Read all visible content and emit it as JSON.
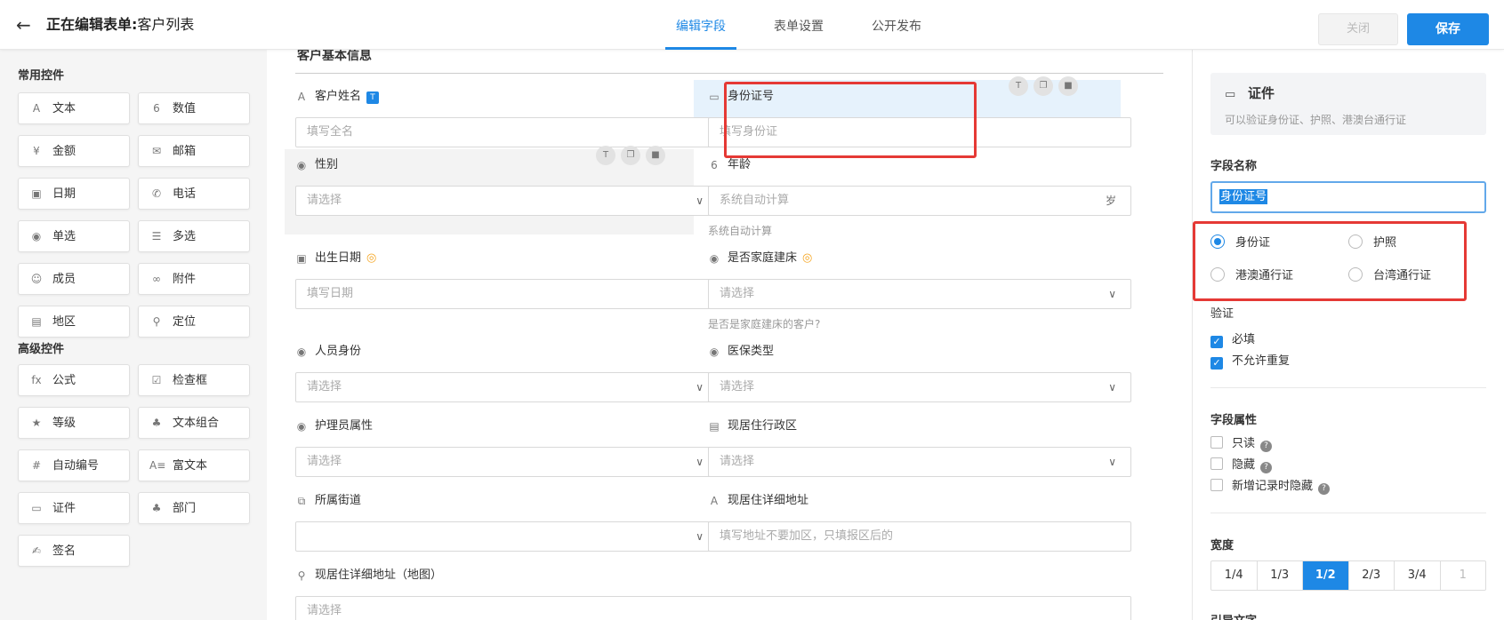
{
  "header": {
    "title_prefix": "正在编辑表单:",
    "form_name": "客户列表",
    "tabs": [
      "编辑字段",
      "表单设置",
      "公开发布"
    ],
    "close_label": "关闭",
    "save_label": "保存"
  },
  "palette": {
    "common_title": "常用控件",
    "advanced_title": "高级控件",
    "common": [
      {
        "label": "文本",
        "icon": "A"
      },
      {
        "label": "数值",
        "icon": "6"
      },
      {
        "label": "金额",
        "icon": "¥"
      },
      {
        "label": "邮箱",
        "icon": "✉"
      },
      {
        "label": "日期",
        "icon": "▣"
      },
      {
        "label": "电话",
        "icon": "✆"
      },
      {
        "label": "单选",
        "icon": "◉"
      },
      {
        "label": "多选",
        "icon": "☰"
      },
      {
        "label": "成员",
        "icon": "☺"
      },
      {
        "label": "附件",
        "icon": "∞"
      },
      {
        "label": "地区",
        "icon": "▤"
      },
      {
        "label": "定位",
        "icon": "⚲"
      }
    ],
    "advanced": [
      {
        "label": "公式",
        "icon": "fx"
      },
      {
        "label": "检查框",
        "icon": "☑"
      },
      {
        "label": "等级",
        "icon": "★"
      },
      {
        "label": "文本组合",
        "icon": "♣"
      },
      {
        "label": "自动编号",
        "icon": "#"
      },
      {
        "label": "富文本",
        "icon": "A≡"
      },
      {
        "label": "证件",
        "icon": "▭"
      },
      {
        "label": "部门",
        "icon": "♣"
      },
      {
        "label": "签名",
        "icon": "✍"
      }
    ]
  },
  "form": {
    "group_title": "客户基本信息",
    "fields": {
      "name": {
        "label": "客户姓名",
        "placeholder": "填写全名",
        "tag": "T"
      },
      "idcard": {
        "label": "身份证号",
        "placeholder": "填写身份证"
      },
      "gender": {
        "label": "性别",
        "placeholder": "请选择"
      },
      "age": {
        "label": "年龄",
        "placeholder": "系统自动计算",
        "unit": "岁",
        "hint": "系统自动计算"
      },
      "birth": {
        "label": "出生日期",
        "placeholder": "填写日期"
      },
      "homebed": {
        "label": "是否家庭建床",
        "placeholder": "请选择",
        "hint": "是否是家庭建床的客户?"
      },
      "identity": {
        "label": "人员身份",
        "placeholder": "请选择"
      },
      "insurance": {
        "label": "医保类型",
        "placeholder": "请选择"
      },
      "nurse": {
        "label": "护理员属性",
        "placeholder": "请选择"
      },
      "district": {
        "label": "现居住行政区",
        "placeholder": "请选择"
      },
      "street": {
        "label": "所属街道",
        "placeholder": ""
      },
      "address": {
        "label": "现居住详细地址",
        "placeholder": "填写地址不要加区，只填报区后的"
      },
      "mapaddr": {
        "label": "现居住详细地址（地图）",
        "placeholder": "请选择"
      }
    }
  },
  "props": {
    "card_title": "证件",
    "card_desc": "可以验证身份证、护照、港澳台通行证",
    "field_name_label": "字段名称",
    "field_name_value": "身份证号",
    "id_types": [
      {
        "label": "身份证",
        "checked": true
      },
      {
        "label": "护照",
        "checked": false
      },
      {
        "label": "港澳通行证",
        "checked": false
      },
      {
        "label": "台湾通行证",
        "checked": false
      }
    ],
    "validation_label": "验证",
    "validation": [
      {
        "label": "必填",
        "checked": true
      },
      {
        "label": "不允许重复",
        "checked": true
      }
    ],
    "attr_label": "字段属性",
    "attrs": [
      {
        "label": "只读",
        "checked": false
      },
      {
        "label": "隐藏",
        "checked": false
      },
      {
        "label": "新增记录时隐藏",
        "checked": false
      }
    ],
    "width_label": "宽度",
    "widths": [
      "1/4",
      "1/3",
      "1/2",
      "2/3",
      "3/4",
      "1"
    ],
    "width_selected": "1/2",
    "guide_label": "引导文字"
  },
  "colors": {
    "accent": "#1e88e5",
    "highlight": "#e53935"
  }
}
